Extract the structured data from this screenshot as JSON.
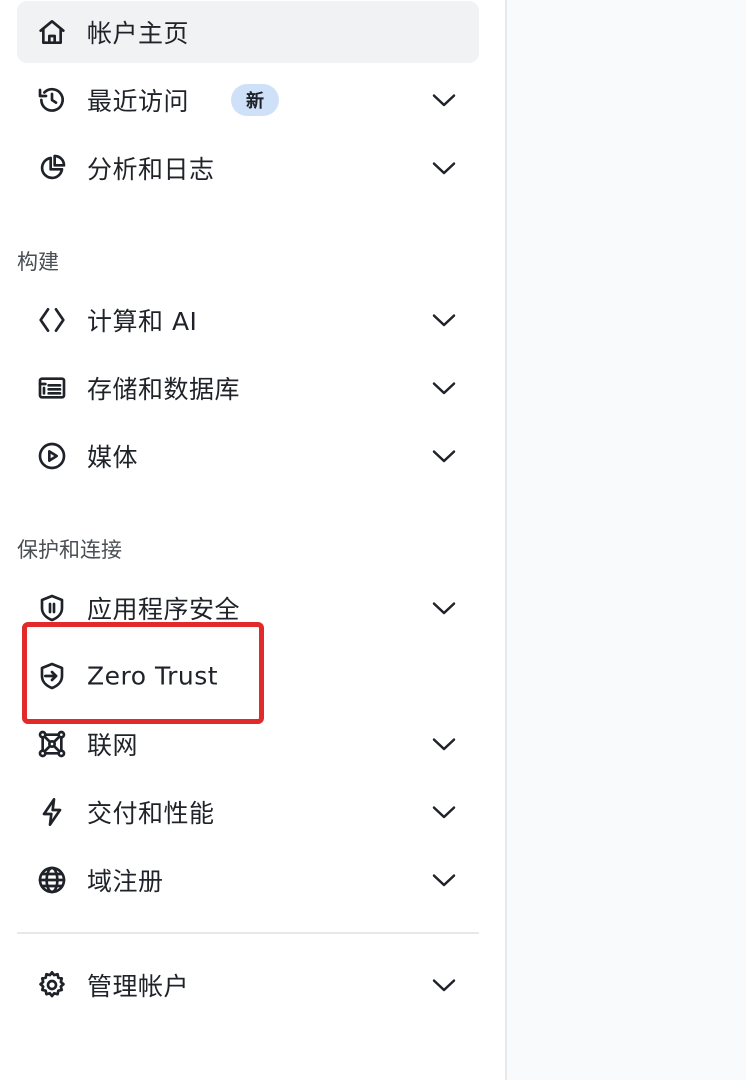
{
  "sidebar": {
    "items": [
      {
        "label": "帐户主页",
        "icon": "home-icon",
        "active": true,
        "has_chevron": false
      },
      {
        "label": "最近访问",
        "icon": "history-icon",
        "badge": "新",
        "has_chevron": true
      },
      {
        "label": "分析和日志",
        "icon": "pie-chart-icon",
        "has_chevron": true
      },
      {
        "label": "计算和 AI",
        "icon": "code-brackets-icon",
        "has_chevron": true
      },
      {
        "label": "存储和数据库",
        "icon": "database-list-icon",
        "has_chevron": true
      },
      {
        "label": "媒体",
        "icon": "play-circle-icon",
        "has_chevron": true
      },
      {
        "label": "应用程序安全",
        "icon": "shield-icon",
        "has_chevron": true
      },
      {
        "label": "Zero Trust",
        "icon": "shield-arrow-icon",
        "has_chevron": false,
        "highlighted": true
      },
      {
        "label": "联网",
        "icon": "network-icon",
        "has_chevron": true
      },
      {
        "label": "交付和性能",
        "icon": "lightning-icon",
        "has_chevron": true
      },
      {
        "label": "域注册",
        "icon": "globe-icon",
        "has_chevron": true
      },
      {
        "label": "管理帐户",
        "icon": "gear-icon",
        "has_chevron": true
      }
    ],
    "sections": {
      "build": "构建",
      "protect": "保护和连接"
    }
  },
  "colors": {
    "highlight_border": "#e22a2a",
    "badge_bg": "#cfe1f9",
    "active_bg": "#f1f2f4"
  }
}
